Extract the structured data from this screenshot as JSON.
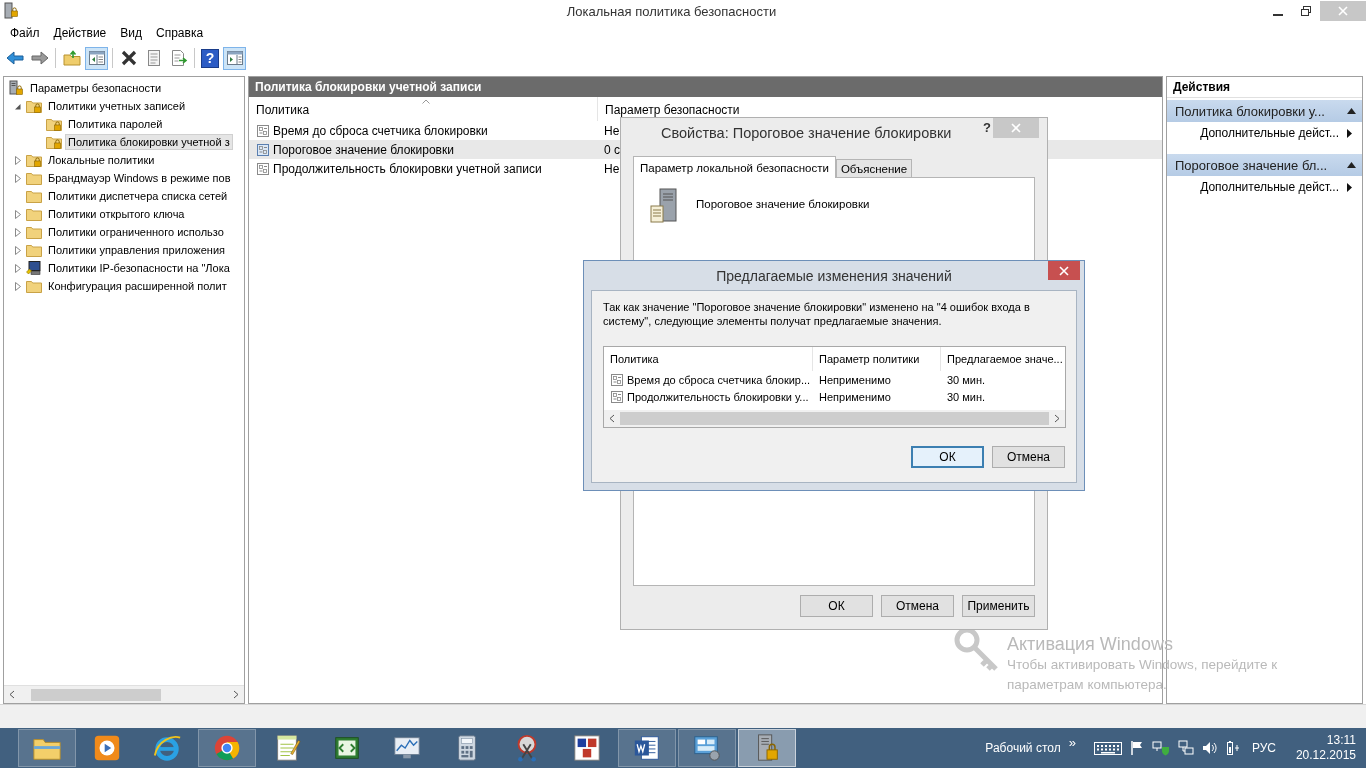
{
  "window": {
    "title": "Локальная политика безопасности"
  },
  "menu": [
    "Файл",
    "Действие",
    "Вид",
    "Справка"
  ],
  "toolbar": [
    [
      {
        "kind": "back",
        "pressed": false
      },
      {
        "kind": "forward",
        "pressed": false
      }
    ],
    [
      {
        "kind": "up",
        "pressed": false
      },
      {
        "kind": "tree",
        "pressed": true
      }
    ],
    [
      {
        "kind": "delete",
        "pressed": false
      },
      {
        "kind": "properties",
        "pressed": false
      },
      {
        "kind": "export",
        "pressed": false
      }
    ],
    [
      {
        "kind": "help",
        "label": "?",
        "pressed": false
      },
      {
        "kind": "actionpane",
        "pressed": true
      }
    ]
  ],
  "tree": [
    {
      "label": "Параметры безопасности",
      "kind": "server",
      "selected": false,
      "children": [
        {
          "label": "Политики учетных записей",
          "kind": "lockfolder",
          "expanded": true,
          "selected": false,
          "children": [
            {
              "label": "Политика паролей",
              "kind": "lockfolder",
              "selected": false
            },
            {
              "label": "Политика блокировки учетной з",
              "kind": "lockfolder",
              "selected": true
            }
          ]
        },
        {
          "label": "Локальные политики",
          "kind": "lockfolder",
          "expanded": false,
          "selected": false
        },
        {
          "label": "Брандмауэр Windows в режиме пов",
          "kind": "folder",
          "expanded": false,
          "selected": false
        },
        {
          "label": "Политики диспетчера списка сетей",
          "kind": "folder",
          "selected": false
        },
        {
          "label": "Политики открытого ключа",
          "kind": "folder",
          "expanded": false,
          "selected": false
        },
        {
          "label": "Политики ограниченного использо",
          "kind": "folder",
          "expanded": false,
          "selected": false
        },
        {
          "label": "Политики управления приложения",
          "kind": "folder",
          "expanded": false,
          "selected": false
        },
        {
          "label": "Политики IP-безопасности на \"Лока",
          "kind": "computer",
          "expanded": false,
          "selected": false
        },
        {
          "label": "Конфигурация расширенной полит",
          "kind": "folder",
          "expanded": false,
          "selected": false
        }
      ]
    }
  ],
  "center": {
    "title": "Политика блокировки учетной записи",
    "columns": [
      "Политика",
      "Параметр безопасности"
    ],
    "rows": [
      {
        "policy": "Время до сброса счетчика блокировки",
        "setting": "Не",
        "selected": false
      },
      {
        "policy": "Пороговое значение блокировки",
        "setting": "0 с",
        "selected": true
      },
      {
        "policy": "Продолжительность блокировки учетной записи",
        "setting": "Не",
        "selected": false
      }
    ]
  },
  "actions": {
    "title": "Действия",
    "groups": [
      {
        "title": "Политика блокировки у...",
        "items": [
          "Дополнительные дейст..."
        ]
      },
      {
        "title": "Пороговое значение бл...",
        "items": [
          "Дополнительные дейст..."
        ]
      }
    ]
  },
  "properties_dialog": {
    "title": "Свойства: Пороговое значение блокировки",
    "help": "?",
    "tabs": [
      {
        "label": "Параметр локальной безопасности",
        "selected": true
      },
      {
        "label": "Объяснение",
        "selected": false
      }
    ],
    "setting_name": "Пороговое значение блокировки",
    "buttons": [
      "ОК",
      "Отмена",
      "Применить"
    ]
  },
  "suggest_dialog": {
    "title": "Предлагаемые изменения значений",
    "message": "Так как значение \"Пороговое значение блокировки\" изменено на \"4 ошибок входа в систему\", следующие элементы получат предлагаемые значения.",
    "columns": [
      "Политика",
      "Параметр политики",
      "Предлагаемое значе..."
    ],
    "rows": [
      {
        "cells": [
          "Время до сброса счетчика блокир...",
          "Неприменимо",
          "30 мин."
        ]
      },
      {
        "cells": [
          "Продолжительность блокировки у...",
          "Неприменимо",
          "30 мин."
        ]
      }
    ],
    "buttons": [
      {
        "label": "ОК",
        "default": true
      },
      {
        "label": "Отмена",
        "default": false
      }
    ]
  },
  "activation": {
    "title": "Активация Windows",
    "lines": [
      "Чтобы активировать Windows, перейдите к",
      "параметрам компьютера."
    ]
  },
  "taskbar": {
    "apps": [
      {
        "kind": "explorer",
        "running": true,
        "selected": false
      },
      {
        "kind": "media",
        "running": false,
        "selected": false
      },
      {
        "kind": "ie",
        "running": false,
        "selected": false
      },
      {
        "kind": "chrome",
        "running": true,
        "selected": false
      },
      {
        "kind": "notepad",
        "running": false,
        "selected": false
      },
      {
        "kind": "code",
        "running": false,
        "selected": false
      },
      {
        "kind": "monitor",
        "running": false,
        "selected": false
      },
      {
        "kind": "calculator",
        "running": false,
        "selected": false
      },
      {
        "kind": "snip",
        "running": false,
        "selected": false
      },
      {
        "kind": "abc",
        "running": false,
        "selected": false
      },
      {
        "kind": "word",
        "running": true,
        "selected": false
      },
      {
        "kind": "control",
        "running": true,
        "selected": false
      },
      {
        "kind": "server",
        "running": true,
        "selected": true
      }
    ],
    "toolbar_label": "Рабочий стол",
    "more": "»",
    "tray": [
      {
        "kind": "keyboard"
      },
      {
        "kind": "flag"
      },
      {
        "kind": "shield"
      },
      {
        "kind": "network"
      },
      {
        "kind": "volume"
      },
      {
        "kind": "power"
      }
    ],
    "language": "РУС",
    "time": "13:11",
    "date": "20.12.2015"
  }
}
